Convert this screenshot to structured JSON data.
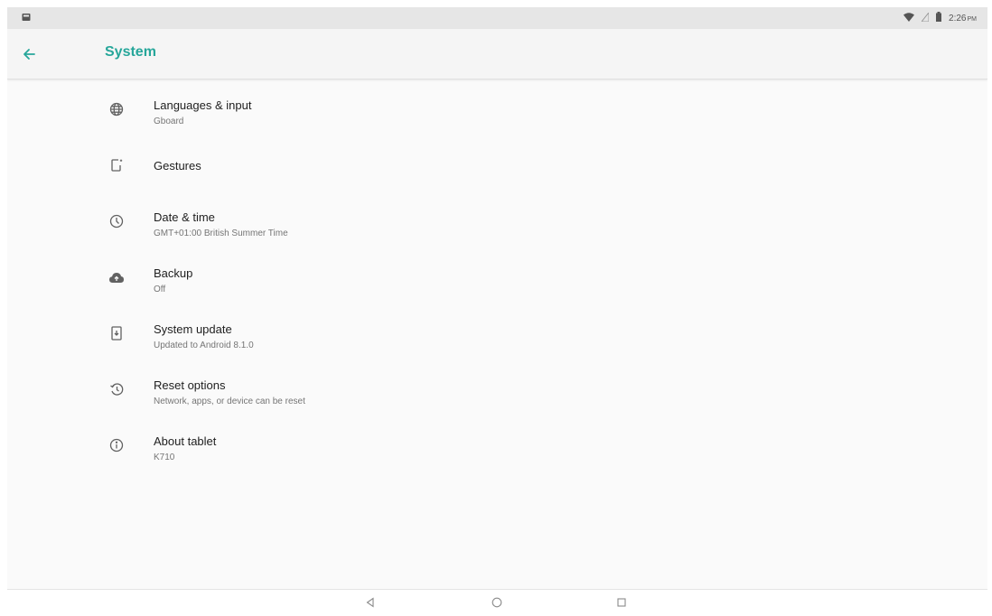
{
  "status_bar": {
    "time": "2:26",
    "ampm": "PM"
  },
  "app_bar": {
    "title": "System",
    "accent_color": "#26a69a"
  },
  "items": [
    {
      "icon": "globe-icon",
      "title": "Languages & input",
      "subtitle": "Gboard"
    },
    {
      "icon": "gestures-icon",
      "title": "Gestures",
      "subtitle": ""
    },
    {
      "icon": "clock-icon",
      "title": "Date & time",
      "subtitle": "GMT+01:00 British Summer Time"
    },
    {
      "icon": "cloud-upload-icon",
      "title": "Backup",
      "subtitle": "Off"
    },
    {
      "icon": "system-update-icon",
      "title": "System update",
      "subtitle": "Updated to Android 8.1.0"
    },
    {
      "icon": "restore-icon",
      "title": "Reset options",
      "subtitle": "Network, apps, or device can be reset"
    },
    {
      "icon": "info-icon",
      "title": "About tablet",
      "subtitle": "K710"
    }
  ]
}
